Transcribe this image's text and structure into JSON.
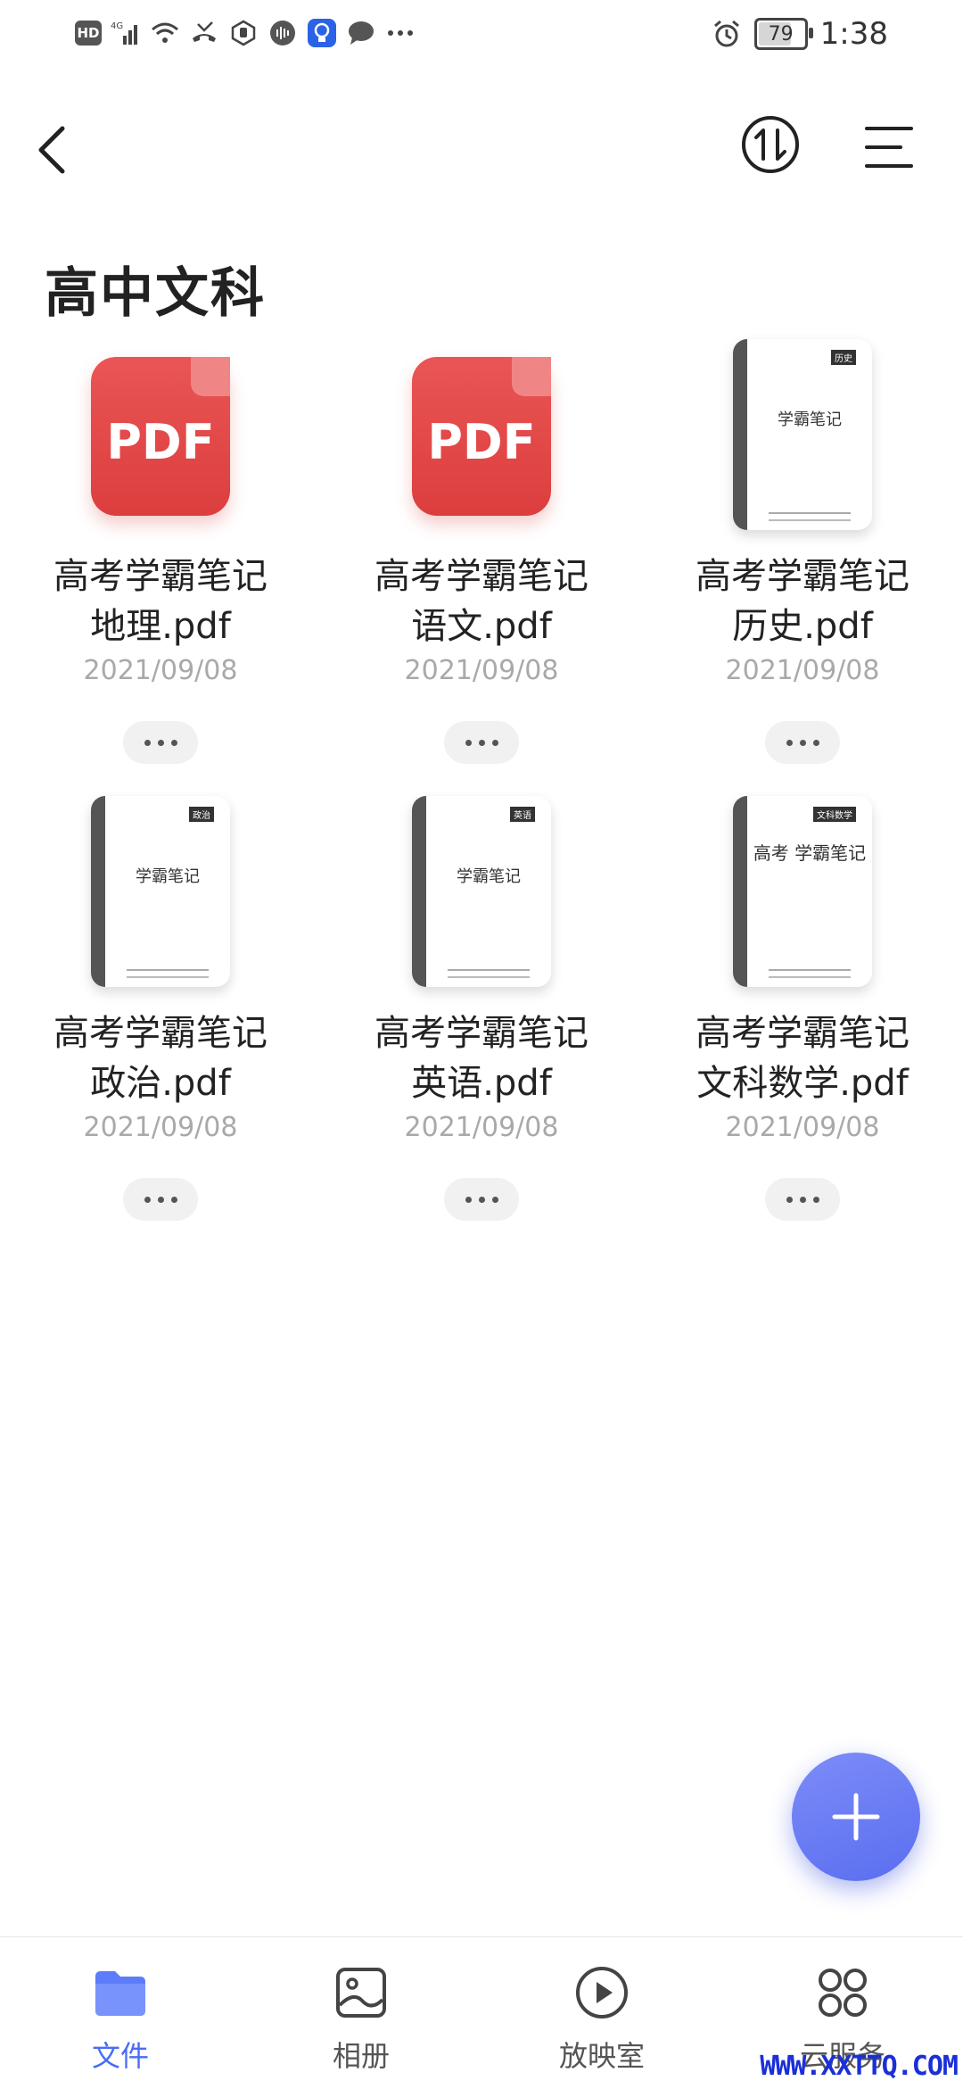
{
  "status_bar": {
    "hd": "HD",
    "signal": "4G",
    "battery": "79",
    "battery_level": 0.79,
    "time": "1:38"
  },
  "header": {
    "title": "高中文科",
    "back_icon": "chevron-left-icon",
    "sort_icon": "sort-arrows-icon",
    "menu_icon": "list-menu-icon"
  },
  "files": [
    {
      "name_line1": "高考学霸笔记",
      "name_line2": "地理.pdf",
      "date": "2021/09/08",
      "thumb": "pdf",
      "thumb_label": "PDF"
    },
    {
      "name_line1": "高考学霸笔记",
      "name_line2": "语文.pdf",
      "date": "2021/09/08",
      "thumb": "pdf",
      "thumb_label": "PDF"
    },
    {
      "name_line1": "高考学霸笔记",
      "name_line2": "历史.pdf",
      "date": "2021/09/08",
      "thumb": "cover",
      "cover_title": "学霸笔记",
      "cover_tag": "历史"
    },
    {
      "name_line1": "高考学霸笔记",
      "name_line2": "政治.pdf",
      "date": "2021/09/08",
      "thumb": "cover",
      "cover_title": "学霸笔记",
      "cover_tag": "政治"
    },
    {
      "name_line1": "高考学霸笔记",
      "name_line2": "英语.pdf",
      "date": "2021/09/08",
      "thumb": "cover",
      "cover_title": "学霸笔记",
      "cover_tag": "英语"
    },
    {
      "name_line1": "高考学霸笔记",
      "name_line2": "文科数学.pdf",
      "date": "2021/09/08",
      "thumb": "cover",
      "cover_title": "高考 学霸笔记",
      "cover_tag": "文科数学"
    }
  ],
  "fab": {
    "icon": "plus-icon"
  },
  "bottom_nav": [
    {
      "label": "文件",
      "icon": "folder-icon",
      "active": true
    },
    {
      "label": "相册",
      "icon": "gallery-icon",
      "active": false
    },
    {
      "label": "放映室",
      "icon": "play-circle-icon",
      "active": false
    },
    {
      "label": "云服务",
      "icon": "cloud-services-icon",
      "active": false
    }
  ],
  "colors": {
    "accent": "#4a6cf7",
    "pdf_red": "#e34848",
    "date_gray": "#a9a9a9"
  },
  "watermark": "WWW.XXTTQ.COM"
}
